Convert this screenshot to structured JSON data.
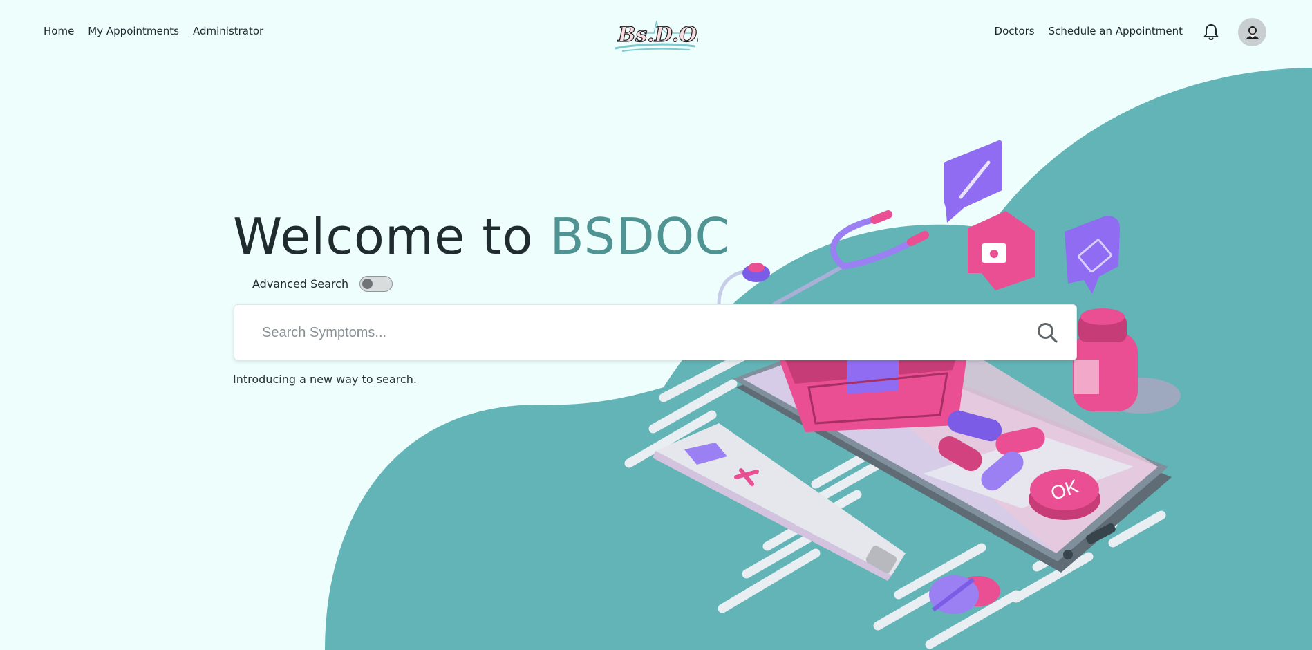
{
  "nav": {
    "left_links": [
      "Home",
      "My Appointments",
      "Administrator"
    ],
    "right_links": [
      "Doctors",
      "Schedule an Appointment"
    ],
    "logo_text": "Bs.D.O.c",
    "icons": {
      "notifications": "bell-icon",
      "profile": "user-avatar-icon"
    }
  },
  "hero": {
    "title_prefix": "Welcome to ",
    "title_brand": "BSDOC",
    "advanced_search_label": "Advanced Search",
    "advanced_search_on": false,
    "search_placeholder": "Search Symptoms...",
    "search_value": "",
    "search_icon": "search-icon",
    "intro_text": "Introducing a new way to search."
  },
  "illustration": {
    "ok_label": "OK"
  },
  "colors": {
    "page_bg": "#eefefd",
    "teal": "#62b4b6",
    "brand_text": "#4f9393",
    "pink": "#e94f92",
    "purple": "#8f6cf2",
    "phone_gray": "#5c6a73"
  }
}
